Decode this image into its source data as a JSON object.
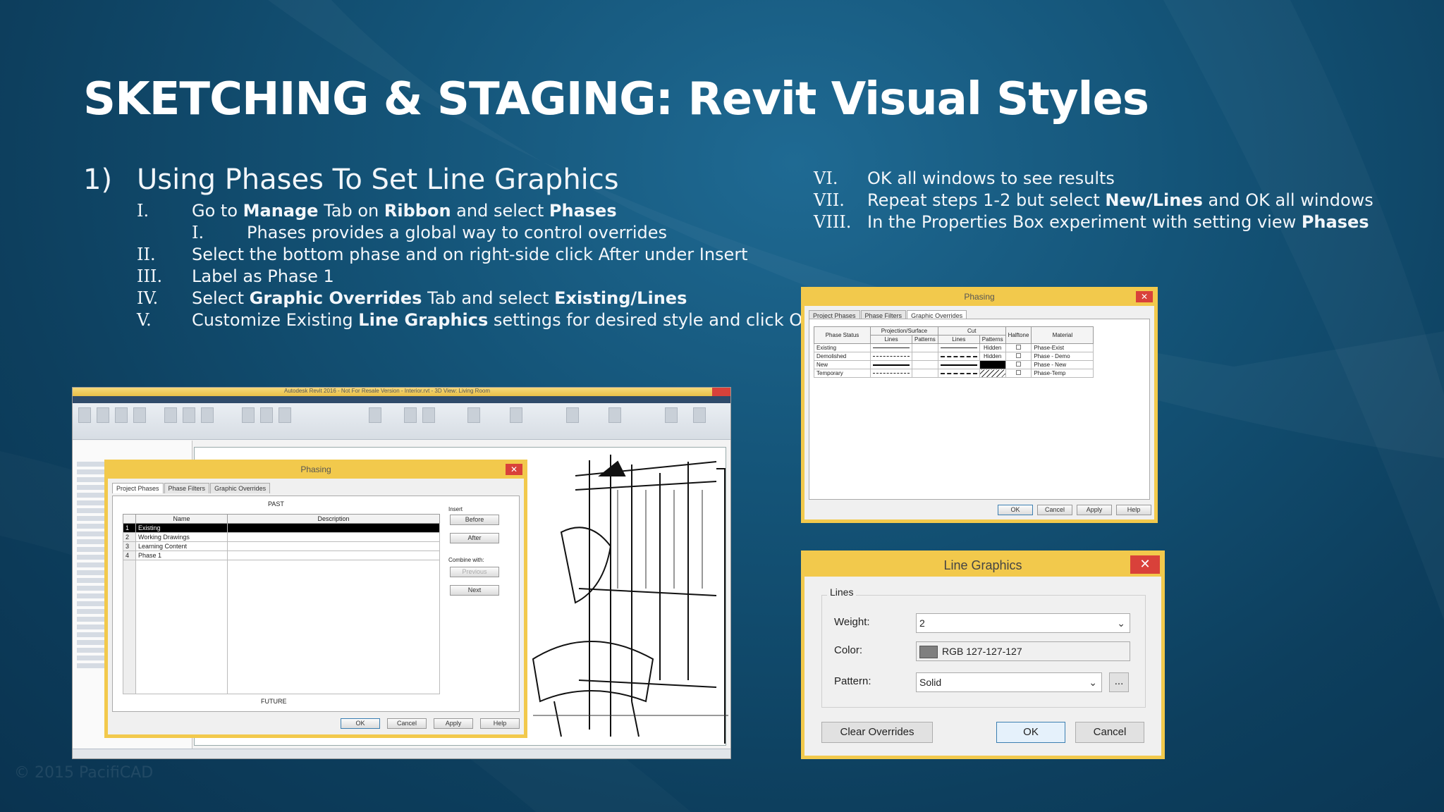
{
  "slide": {
    "title": "SKETCHING & STAGING: Revit Visual Styles",
    "section_num": "1)",
    "section_title": "Using Phases To Set Line Graphics",
    "watermark": "© 2015 PacifiCAD"
  },
  "steps_left": [
    {
      "num": "I.",
      "parts": [
        "Go to ",
        "Manage",
        " Tab on ",
        "Ribbon",
        " and select ",
        "Phases"
      ]
    },
    {
      "num": "I.",
      "text": "Phases provides a global way to control overrides"
    },
    {
      "num": "II.",
      "text": "Select the bottom phase and on right-side click After under Insert"
    },
    {
      "num": "III.",
      "text": "Label as Phase 1"
    },
    {
      "num": "IV.",
      "parts": [
        "Select ",
        "Graphic Overrides",
        " Tab and select ",
        "Existing/Lines"
      ]
    },
    {
      "num": "V.",
      "parts": [
        "Customize Existing ",
        "Line Graphics",
        " settings for desired style and click OK"
      ]
    }
  ],
  "steps_right": [
    {
      "num": "VI.",
      "text": "OK all windows to see results"
    },
    {
      "num": "VII.",
      "parts": [
        "Repeat steps 1-2 but select ",
        "New/Lines",
        " and OK all windows"
      ]
    },
    {
      "num": "VIII.",
      "parts": [
        "In the Properties Box experiment with setting view ",
        "Phases"
      ]
    }
  ],
  "revit_window": {
    "title": "Autodesk Revit 2016 - Not For Resale Version - Interior.rvt - 3D View: Living Room"
  },
  "phasing_dialog_a": {
    "title": "Phasing",
    "close": "✕",
    "tabs": [
      "Project Phases",
      "Phase Filters",
      "Graphic Overrides"
    ],
    "past_label": "PAST",
    "future_label": "FUTURE",
    "col_name": "Name",
    "col_description": "Description",
    "rows": [
      {
        "n": "1",
        "name": "Existing"
      },
      {
        "n": "2",
        "name": "Working Drawings"
      },
      {
        "n": "3",
        "name": "Learning Content"
      },
      {
        "n": "4",
        "name": "Phase 1"
      }
    ],
    "insert_label": "Insert",
    "before": "Before",
    "after": "After",
    "combine_label": "Combine with:",
    "previous": "Previous",
    "next": "Next",
    "ok": "OK",
    "cancel": "Cancel",
    "apply": "Apply",
    "help": "Help"
  },
  "phasing_dialog_b": {
    "title": "Phasing",
    "close": "✕",
    "tabs": [
      "Project Phases",
      "Phase Filters",
      "Graphic Overrides"
    ],
    "headers": {
      "phase_status": "Phase Status",
      "projection": "Projection/Surface",
      "cut": "Cut",
      "halftone": "Halftone",
      "material": "Material",
      "lines": "Lines",
      "patterns": "Patterns"
    },
    "rows": [
      {
        "status": "Existing",
        "cut_pattern": "Hidden",
        "material": "Phase-Exist"
      },
      {
        "status": "Demolished",
        "cut_pattern": "Hidden",
        "material": "Phase - Demo"
      },
      {
        "status": "New",
        "cut_pattern": "",
        "material": "Phase - New"
      },
      {
        "status": "Temporary",
        "cut_pattern": "",
        "material": "Phase-Temp"
      }
    ],
    "ok": "OK",
    "cancel": "Cancel",
    "apply": "Apply",
    "help": "Help"
  },
  "line_graphics": {
    "title": "Line Graphics",
    "close": "✕",
    "group_label": "Lines",
    "weight_label": "Weight:",
    "weight_value": "2",
    "color_label": "Color:",
    "color_value": "RGB 127-127-127",
    "color_swatch": "#7f7f7f",
    "pattern_label": "Pattern:",
    "pattern_value": "Solid",
    "more": "...",
    "clear_overrides": "Clear Overrides",
    "ok": "OK",
    "cancel": "Cancel"
  }
}
